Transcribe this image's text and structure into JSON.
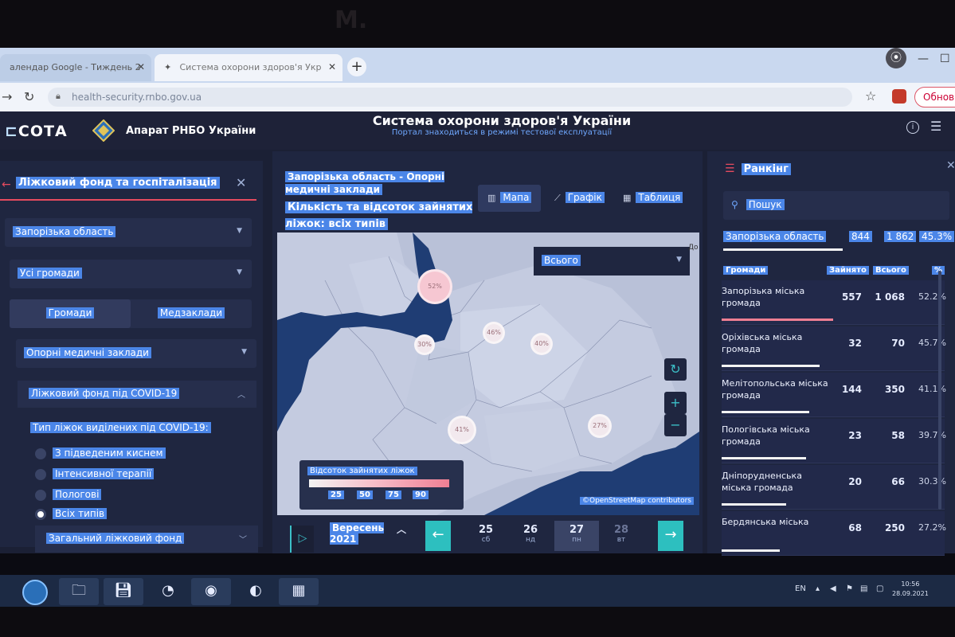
{
  "browser": {
    "tabs": [
      {
        "label": "алендар Google - Тиждень 2"
      },
      {
        "label": "Система охорони здоров'я Укр"
      }
    ],
    "new_tab": "+",
    "url": "health-security.rnbo.gov.ua",
    "update_label": "Обновите"
  },
  "app": {
    "logo": "СОТА",
    "org": "Апарат РНБО України",
    "title": "Система охорони здоров'я України",
    "subtitle": "Портал знаходиться в режимі тестової експлуатації"
  },
  "left_panel": {
    "title": "Ліжковий фонд та госпіталізація",
    "region": "Запорізька область",
    "communities": "Усі громади",
    "toggle": [
      "Громади",
      "Медзаклади"
    ],
    "facility_type": "Опорні медичні заклади",
    "accordion_open": "Ліжковий фонд під COVID-19",
    "radio_title": "Тип ліжок виділених під COVID-19:",
    "radios": [
      {
        "label": "З підведеним киснем",
        "checked": false
      },
      {
        "label": "Інтенсивної терапії",
        "checked": false
      },
      {
        "label": "Пологові",
        "checked": false
      },
      {
        "label": "Всіх типів",
        "checked": true
      }
    ],
    "accordion_closed": "Загальний ліжковий фонд"
  },
  "center": {
    "title1": "Запорізька область - Опорні медичні заклади",
    "title2": "Кількість та відсоток зайнятих ліжок: всіх типів",
    "views": [
      "Мапа",
      "Графік",
      "Таблиця"
    ],
    "active_view": "Мапа",
    "map_filter": "Всього",
    "clusters": [
      "52%",
      "30%",
      "46%",
      "40%",
      "41%",
      "27%"
    ],
    "legend_title": "Відсоток зайнятих ліжок",
    "legend_ticks": [
      "25",
      "50",
      "75",
      "90"
    ],
    "attribution": "©OpenStreetMap contributors",
    "map_edge_label": "До",
    "timeline": {
      "month": "Вересень 2021",
      "days": [
        {
          "num": "25",
          "dow": "сб"
        },
        {
          "num": "26",
          "dow": "нд"
        },
        {
          "num": "27",
          "dow": "пн"
        },
        {
          "num": "28",
          "dow": "вт"
        }
      ],
      "current_day": "27"
    }
  },
  "ranking": {
    "title": "Ранкінг",
    "search_placeholder": "Пошук",
    "total": {
      "name": "Запорізька область",
      "occupied": "844",
      "all": "1 862",
      "pct": "45.3%"
    },
    "headers": {
      "name": "Громади",
      "occupied": "Зайнято",
      "all": "Всього",
      "pct": "%"
    },
    "rows": [
      {
        "name": "Запорізька міська громада",
        "occupied": "557",
        "all": "1 068",
        "pct": "52.2%",
        "value": 52.2
      },
      {
        "name": "Оріхівська міська громада",
        "occupied": "32",
        "all": "70",
        "pct": "45.7%",
        "value": 45.7
      },
      {
        "name": "Мелітопольська міська громада",
        "occupied": "144",
        "all": "350",
        "pct": "41.1%",
        "value": 41.1
      },
      {
        "name": "Пологівська міська громада",
        "occupied": "23",
        "all": "58",
        "pct": "39.7%",
        "value": 39.7
      },
      {
        "name": "Дніпорудненська міська громада",
        "occupied": "20",
        "all": "66",
        "pct": "30.3%",
        "value": 30.3
      },
      {
        "name": "Бердянська міська",
        "occupied": "68",
        "all": "250",
        "pct": "27.2%",
        "value": 27.2
      }
    ]
  },
  "taskbar": {
    "lang": "EN",
    "time": "10:56",
    "date": "28.09.2021"
  },
  "colors": {
    "accent": "#4b86e8",
    "red_accent": "#e64b5f",
    "teal": "#2dbfbf",
    "panel": "#1f2640"
  }
}
